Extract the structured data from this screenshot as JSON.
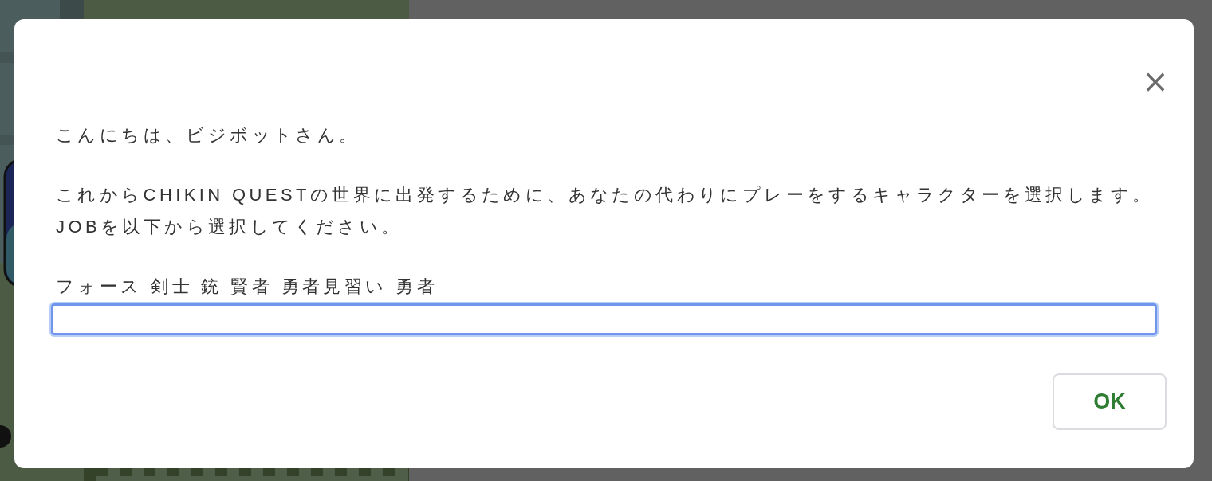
{
  "dialog": {
    "close_label": "×",
    "paragraphs": [
      [
        "こんにちは、ビジボットさん。"
      ],
      [
        "これからCHIKIN QUESTの世界に出発するために、あなたの代わりにプレーをするキャラクターを選択します。",
        "JOBを以下から選択してください。"
      ],
      [
        "フォース 剣士 銃 賢者 勇者見習い 勇者"
      ]
    ],
    "input": {
      "focused": true
    },
    "buttons": [
      "OK"
    ]
  }
}
